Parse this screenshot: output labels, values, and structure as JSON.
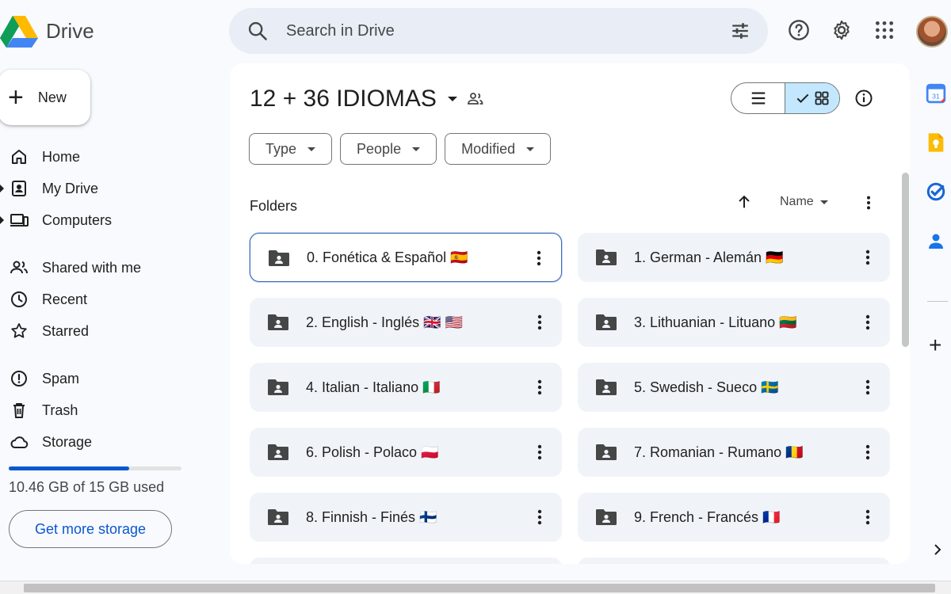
{
  "brand": {
    "name": "Drive"
  },
  "search": {
    "placeholder": "Search in Drive"
  },
  "new_button": {
    "label": "New"
  },
  "nav": {
    "items": [
      {
        "label": "Home",
        "icon": "home-icon"
      },
      {
        "label": "My Drive",
        "icon": "my-drive-icon"
      },
      {
        "label": "Computers",
        "icon": "computers-icon"
      },
      {
        "label": "Shared with me",
        "icon": "shared-icon"
      },
      {
        "label": "Recent",
        "icon": "clock-icon"
      },
      {
        "label": "Starred",
        "icon": "star-icon"
      },
      {
        "label": "Spam",
        "icon": "spam-icon"
      },
      {
        "label": "Trash",
        "icon": "trash-icon"
      },
      {
        "label": "Storage",
        "icon": "cloud-icon"
      }
    ]
  },
  "storage": {
    "used_text": "10.46 GB of 15 GB used",
    "used_fraction": 0.697,
    "cta": "Get more storage"
  },
  "main": {
    "title": "12 + 36 IDIOMAS",
    "filters": [
      "Type",
      "People",
      "Modified"
    ],
    "section_label": "Folders",
    "sort_label": "Name",
    "folders": [
      {
        "name": "0. Fonética & Español 🇪🇸",
        "selected": true
      },
      {
        "name": "1. German - Alemán 🇩🇪",
        "selected": false
      },
      {
        "name": "2. English - Inglés 🇬🇧 🇺🇸",
        "selected": false
      },
      {
        "name": "3. Lithuanian - Lituano 🇱🇹",
        "selected": false
      },
      {
        "name": "4. Italian - Italiano 🇮🇹",
        "selected": false
      },
      {
        "name": "5. Swedish - Sueco 🇸🇪",
        "selected": false
      },
      {
        "name": "6. Polish - Polaco 🇵🇱",
        "selected": false
      },
      {
        "name": "7. Romanian - Rumano 🇷🇴",
        "selected": false
      },
      {
        "name": "8. Finnish - Finés 🇫🇮",
        "selected": false
      },
      {
        "name": "9. French - Francés 🇫🇷",
        "selected": false
      }
    ]
  },
  "side_apps": [
    "calendar-icon",
    "keep-icon",
    "tasks-icon",
    "contacts-icon"
  ],
  "colors": {
    "accent": "#0b57d0",
    "selected_bg": "#c2e7ff",
    "folder_bg": "#f0f4f9"
  }
}
